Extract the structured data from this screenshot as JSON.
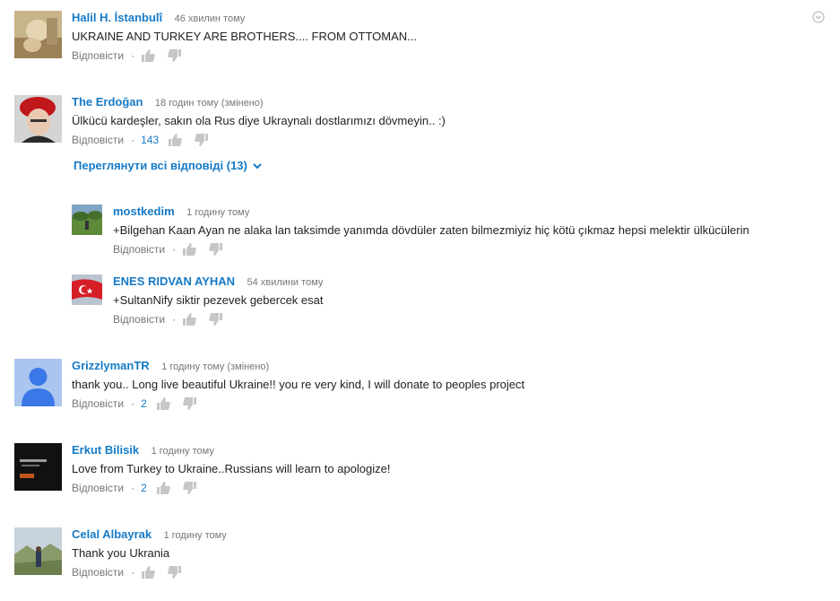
{
  "comments": [
    {
      "author": "Halil H. İstanbulî",
      "time": "46 хвилин тому",
      "text": "UKRAINE AND TURKEY ARE BROTHERS....  FROM OTTOMAN...",
      "reply_label": "Відповісти",
      "likes": ""
    },
    {
      "author": "The Erdoğan",
      "time": "18 годин тому (змінено)",
      "text": "Ülkücü kardeşler, sakın ola Rus diye Ukraynalı dostlarımızı dövmeyin.. :)",
      "reply_label": "Відповісти",
      "likes": "143",
      "view_replies": "Переглянути всі відповіді (13)",
      "replies": [
        {
          "author": "mostkedim",
          "time": "1 годину тому",
          "text": "+Bilgehan Kaan Ayan ne alaka lan taksimde yanımda dövdüler zaten bilmezmiyiz hiç kötü çıkmaz hepsi melektir ülkücülerin",
          "reply_label": "Відповісти"
        },
        {
          "author": "ENES RIDVAN AYHAN",
          "time": "54 хвилини тому",
          "text": "+SultanNify siktir pezevek gebercek esat",
          "reply_label": "Відповісти"
        }
      ]
    },
    {
      "author": "GrizzlymanTR",
      "time": "1 годину тому (змінено)",
      "text": "thank you.. Long live beautiful Ukraine!! you re very kind, I will donate to peoples project",
      "reply_label": "Відповісти",
      "likes": "2"
    },
    {
      "author": "Erkut Bilisik",
      "time": "1 годину тому",
      "text": "Love from Turkey to Ukraine..Russians will learn to apologize!",
      "reply_label": "Відповісти",
      "likes": "2"
    },
    {
      "author": "Celal Albayrak",
      "time": "1 годину тому",
      "text": "Thank you Ukrania",
      "reply_label": "Відповісти",
      "likes": ""
    }
  ],
  "colors": {
    "link": "#167ac6",
    "muted": "#767676",
    "text": "#222222"
  },
  "icons": {
    "like": "thumb-up-icon",
    "dislike": "thumb-down-icon",
    "menu": "chevron-down-circle-icon"
  }
}
